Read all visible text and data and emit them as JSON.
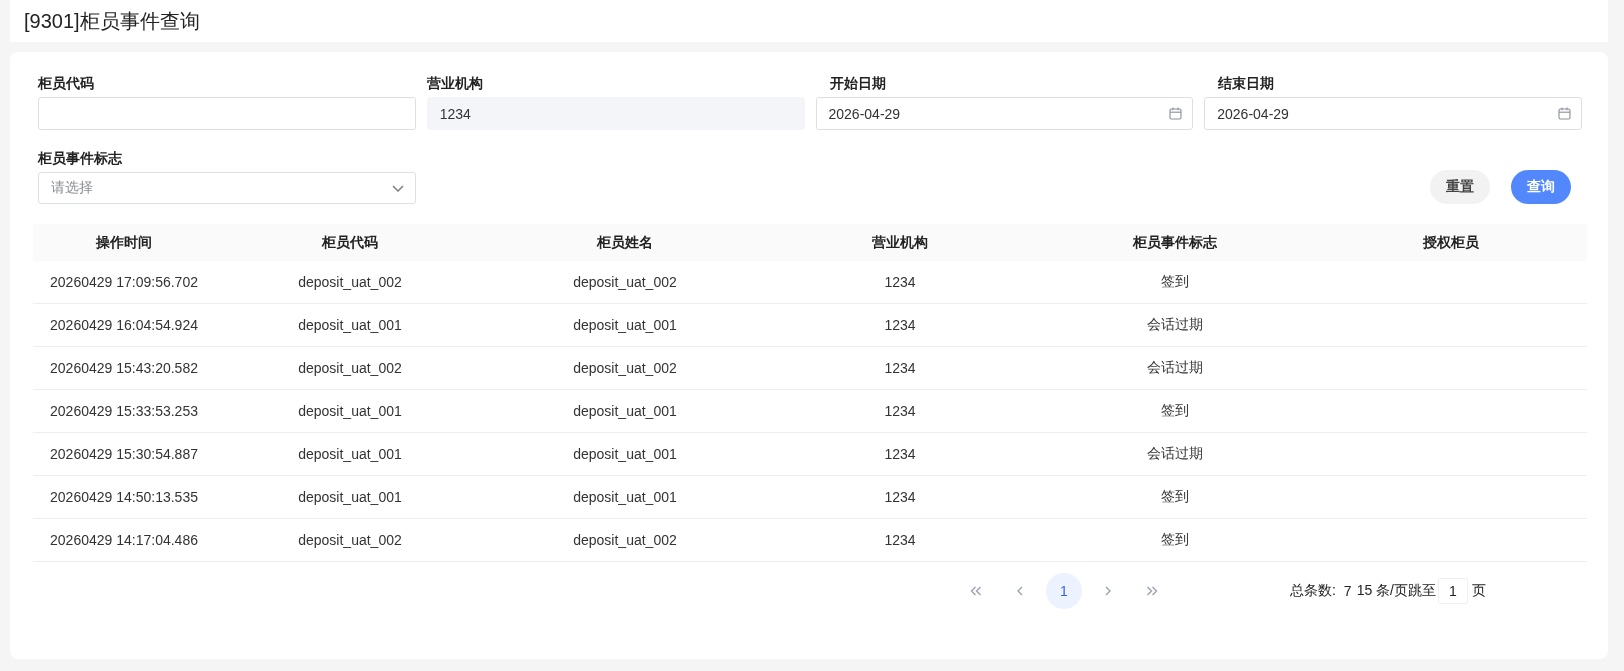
{
  "page": {
    "title": "[9301]柜员事件查询"
  },
  "filters": [
    {
      "label": "柜员代码",
      "kind": "text",
      "disabled": false
    },
    {
      "label": "营业机构",
      "kind": "text",
      "value": "1234",
      "disabled": true
    },
    {
      "label": "开始日期",
      "kind": "date",
      "value": "2026-04-29",
      "disabled": false
    },
    {
      "label": "结束日期",
      "kind": "date",
      "value": "2026-04-29",
      "disabled": false
    },
    {
      "label": "柜员事件标志",
      "kind": "select",
      "placeholder": "请选择",
      "disabled": false
    }
  ],
  "buttons": [
    {
      "label": "重置",
      "kind": "secondary"
    },
    {
      "label": "查询",
      "kind": "primary"
    }
  ],
  "table": {
    "columns": [
      "操作时间",
      "柜员代码",
      "柜员姓名",
      "营业机构",
      "柜员事件标志",
      "授权柜员"
    ],
    "rows": [
      [
        "20260429 17:09:56.702",
        "deposit_uat_002",
        "deposit_uat_002",
        "1234",
        "签到"
      ],
      [
        "20260429 16:04:54.924",
        "deposit_uat_001",
        "deposit_uat_001",
        "1234",
        "会话过期"
      ],
      [
        "20260429 15:43:20.582",
        "deposit_uat_002",
        "deposit_uat_002",
        "1234",
        "会话过期"
      ],
      [
        "20260429 15:33:53.253",
        "deposit_uat_001",
        "deposit_uat_001",
        "1234",
        "签到"
      ],
      [
        "20260429 15:30:54.887",
        "deposit_uat_001",
        "deposit_uat_001",
        "1234",
        "会话过期"
      ],
      [
        "20260429 14:50:13.535",
        "deposit_uat_001",
        "deposit_uat_001",
        "1234",
        "签到"
      ],
      [
        "20260429 14:17:04.486",
        "deposit_uat_002",
        "deposit_uat_002",
        "1234",
        "签到"
      ]
    ]
  },
  "pagination": {
    "pages": [
      {
        "label": "1",
        "selected": true
      }
    ],
    "total_label": "总条数:",
    "total": "7",
    "page_size": "15 条/页",
    "jump_label": "跳至",
    "jump_value": "1",
    "unit": "页"
  }
}
